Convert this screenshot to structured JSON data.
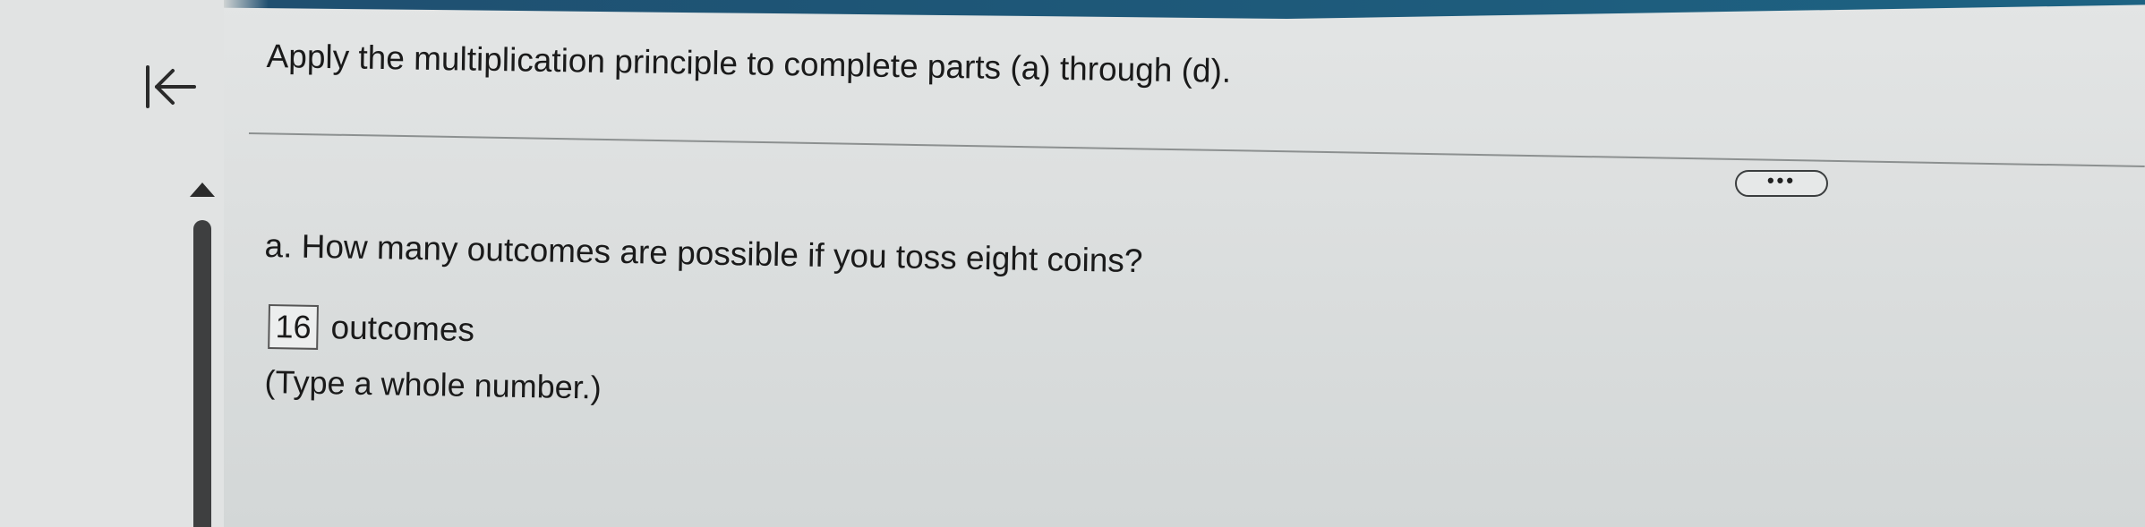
{
  "header": {
    "instruction": "Apply the multiplication principle to complete parts (a) through (d)."
  },
  "nav": {
    "back_icon": "arrow-left-to-bar-icon",
    "scroll_up_icon": "triangle-up-icon"
  },
  "toolbar": {
    "more_label": "•••"
  },
  "part_a": {
    "question": "a. How many outcomes are possible if you toss eight coins?",
    "answer_value": "16",
    "answer_unit": "outcomes",
    "hint": "(Type a whole number.)"
  },
  "colors": {
    "accent_bar": "#1d6383",
    "text": "#1a1a1a",
    "scrollbar": "#3e3f40"
  }
}
